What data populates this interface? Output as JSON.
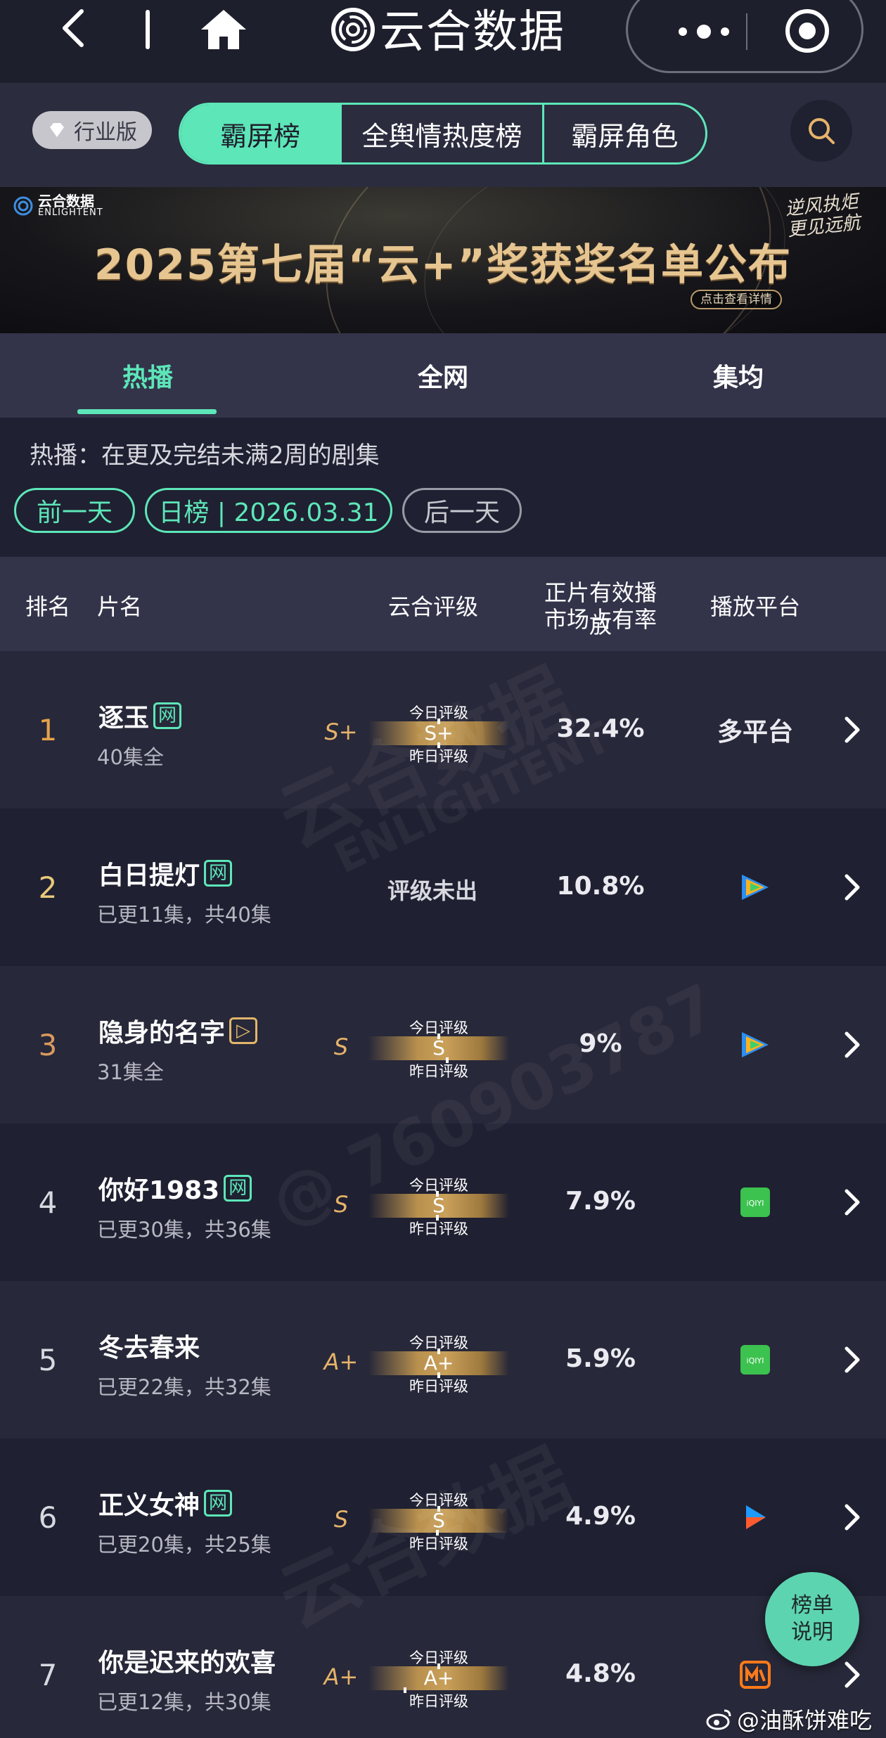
{
  "app": {
    "title": "云合数据"
  },
  "header": {
    "edition": "行业版",
    "tabs": [
      "霸屏榜",
      "全舆情热度榜",
      "霸屏角色"
    ],
    "active_tab": "霸屏榜"
  },
  "banner": {
    "brand": "云合数据",
    "brand_en": "ENLIGHTENT",
    "title": "2025第七届“云+”奖获奖名单公布",
    "slogan": "逆风执炬 更见远航",
    "detail_button": "点击查看详情"
  },
  "subtabs": [
    "热播",
    "全网",
    "集均"
  ],
  "description": "热播：在更及完结未满2周的剧集",
  "date_nav": {
    "prev": "前一天",
    "current": "日榜 | 2026.03.31",
    "next": "后一天"
  },
  "table_header": {
    "rank": "排名",
    "title": "片名",
    "rating": "云合评级",
    "share_line1": "正片有效播放",
    "share_line2": "市场占有率",
    "platform": "播放平台"
  },
  "gauge_labels": {
    "today": "今日评级",
    "yesterday": "昨日评级"
  },
  "rows": [
    {
      "rank": "1",
      "name": "逐玉",
      "tag": "网",
      "episodes": "40集全",
      "grade": "S+",
      "today": "S+",
      "share": "32.4%",
      "platform": "多平台",
      "platform_icon": "multi-platform-text"
    },
    {
      "rank": "2",
      "name": "白日提灯",
      "tag": "网",
      "episodes": "已更11集，共40集",
      "grade": "",
      "today": "",
      "no_rating": "评级未出",
      "share": "10.8%",
      "platform": "",
      "platform_icon": "tencent-video-icon"
    },
    {
      "rank": "3",
      "name": "隐身的名字",
      "tag": "▷",
      "episodes": "31集全",
      "grade": "S",
      "today": "S",
      "share": "9%",
      "platform": "",
      "platform_icon": "tencent-video-icon"
    },
    {
      "rank": "4",
      "name": "你好1983",
      "tag": "网",
      "episodes": "已更30集，共36集",
      "grade": "S",
      "today": "S",
      "share": "7.9%",
      "platform": "",
      "platform_icon": "iqiyi-icon"
    },
    {
      "rank": "5",
      "name": "冬去春来",
      "tag": "",
      "episodes": "已更22集，共32集",
      "grade": "A+",
      "today": "A+",
      "share": "5.9%",
      "platform": "",
      "platform_icon": "iqiyi-icon"
    },
    {
      "rank": "6",
      "name": "正义女神",
      "tag": "网",
      "episodes": "已更20集，共25集",
      "grade": "S",
      "today": "S",
      "share": "4.9%",
      "platform": "",
      "platform_icon": "youku-icon"
    },
    {
      "rank": "7",
      "name": "你是迟来的欢喜",
      "tag": "",
      "episodes": "已更12集，共30集",
      "grade": "A+",
      "today": "A+",
      "share": "4.8%",
      "platform": "",
      "platform_icon": "mango-tv-icon"
    }
  ],
  "watermarks": [
    "云合数据",
    "ENLIGHTENT",
    "@ 760903787"
  ],
  "fab": {
    "line1": "榜单",
    "line2": "说明"
  },
  "credit": "@油酥饼难吃",
  "colors": {
    "accent": "#5de6b8",
    "gold": "#e6b36a",
    "background": "#1f2031"
  }
}
